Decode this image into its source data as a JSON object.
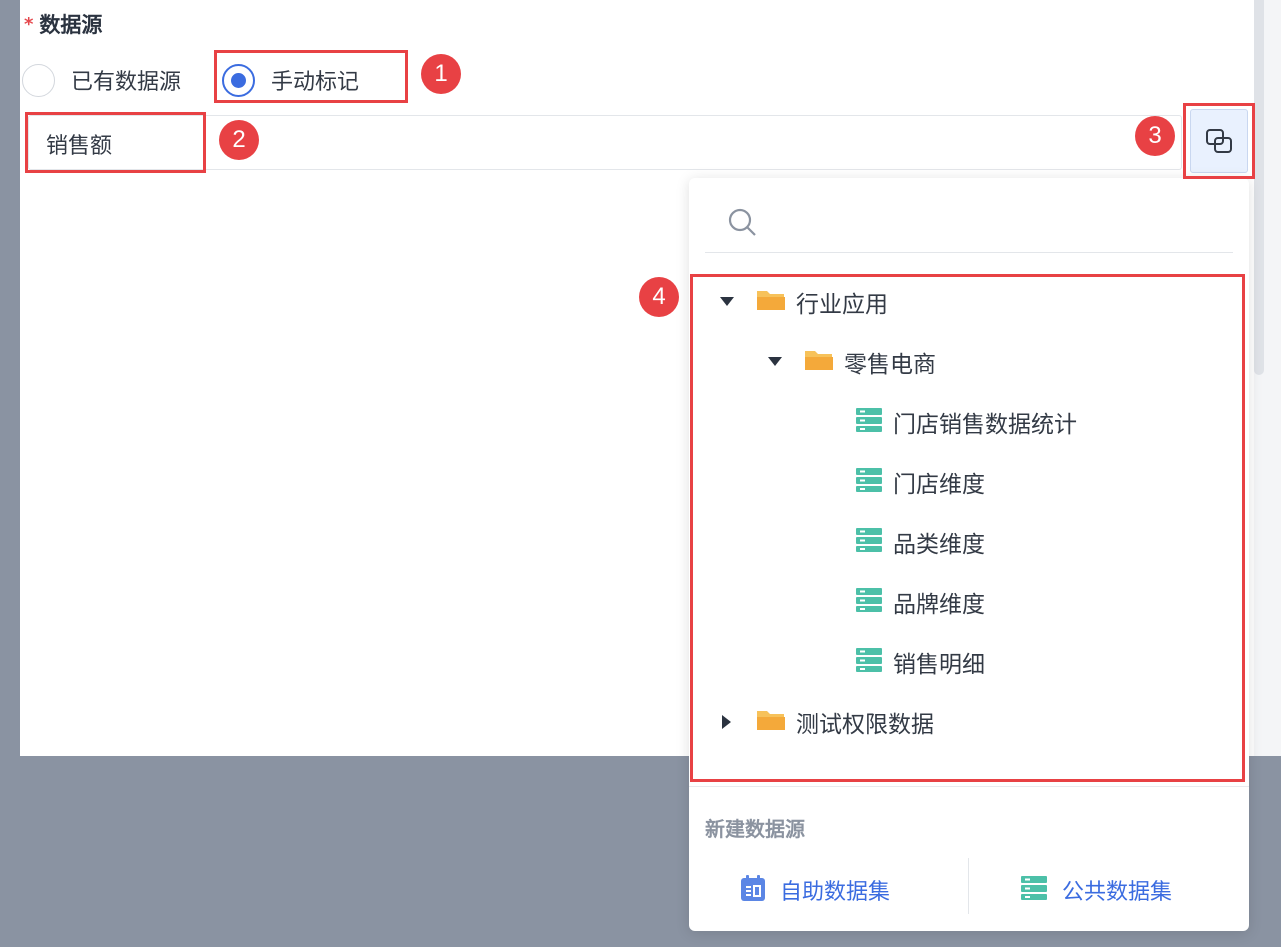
{
  "form": {
    "section_title": "数据源",
    "required_mark": "*",
    "radio_options": [
      {
        "label": "已有数据源",
        "checked": false
      },
      {
        "label": "手动标记",
        "checked": true
      }
    ],
    "field_value": "销售额"
  },
  "annotations": [
    "1",
    "2",
    "3",
    "4"
  ],
  "dropdown": {
    "search_placeholder": "",
    "tree": [
      {
        "label": "行业应用",
        "type": "folder",
        "expanded": true,
        "level": 0
      },
      {
        "label": "零售电商",
        "type": "folder",
        "expanded": true,
        "level": 1
      },
      {
        "label": "门店销售数据统计",
        "type": "table",
        "level": 2
      },
      {
        "label": "门店维度",
        "type": "table",
        "level": 2
      },
      {
        "label": "品类维度",
        "type": "table",
        "level": 2
      },
      {
        "label": "品牌维度",
        "type": "table",
        "level": 2
      },
      {
        "label": "销售明细",
        "type": "table",
        "level": 2
      },
      {
        "label": "测试权限数据",
        "type": "folder",
        "expanded": false,
        "level": 0
      }
    ],
    "footer": {
      "title": "新建数据源",
      "buttons": [
        {
          "label": "自助数据集",
          "icon": "calendar-dataset-icon"
        },
        {
          "label": "公共数据集",
          "icon": "table-dataset-icon"
        }
      ]
    }
  },
  "colors": {
    "accent": "#3b6ce0",
    "annotation_red": "#e84144",
    "folder_yellow": "#f6b73c",
    "table_green": "#4cc0a8",
    "backdrop": "#8a93a2"
  }
}
